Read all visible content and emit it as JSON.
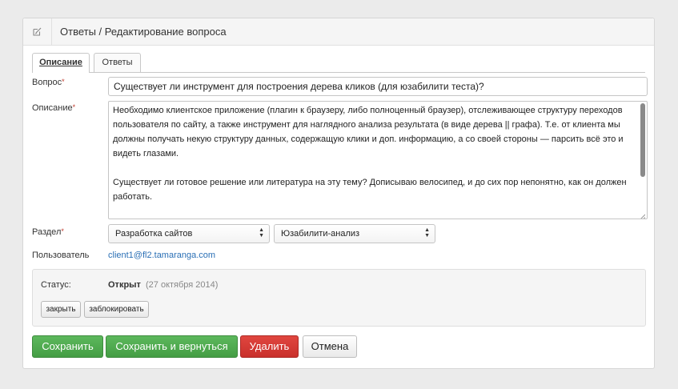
{
  "header": {
    "title": "Ответы / Редактирование вопроса",
    "icon": "edit-icon"
  },
  "tabs": [
    {
      "label": "Описание",
      "active": true
    },
    {
      "label": "Ответы",
      "active": false
    }
  ],
  "form": {
    "question": {
      "label": "Вопрос",
      "required_mark": "*",
      "value": "Существует ли инструмент для построения дерева кликов (для юзабилити теста)?"
    },
    "description": {
      "label": "Описание",
      "required_mark": "*",
      "paragraphs": [
        "Необходимо клиентское приложение (плагин к браузеру, либо полноценный браузер), отслеживающее структуру переходов пользователя по сайту, а также инструмент для наглядного анализа результата (в виде дерева || графа). Т.е. от клиента мы должны получать некую структуру данных, содержащую клики и доп. информацию, а со своей стороны — парсить всё это и видеть глазами.",
        "Существует ли готовое решение или литература на эту тему? Дописываю велосипед, и до сих пор непонятно, как он должен работать."
      ]
    },
    "section": {
      "label": "Раздел",
      "required_mark": "*",
      "select1": "Разработка сайтов",
      "select2": "Юзабилити-анализ"
    },
    "user": {
      "label": "Пользователь",
      "value": "client1@fl2.tamaranga.com"
    }
  },
  "status": {
    "label": "Статус:",
    "value": "Открыт",
    "date": "(27 октября 2014)",
    "close_button": "закрыть",
    "block_button": "заблокировать"
  },
  "actions": {
    "save": "Сохранить",
    "save_return": "Сохранить и вернуться",
    "delete": "Удалить",
    "cancel": "Отмена"
  },
  "colors": {
    "green": "#5cb85c",
    "red": "#d9534f",
    "link": "#2a6fb5"
  }
}
